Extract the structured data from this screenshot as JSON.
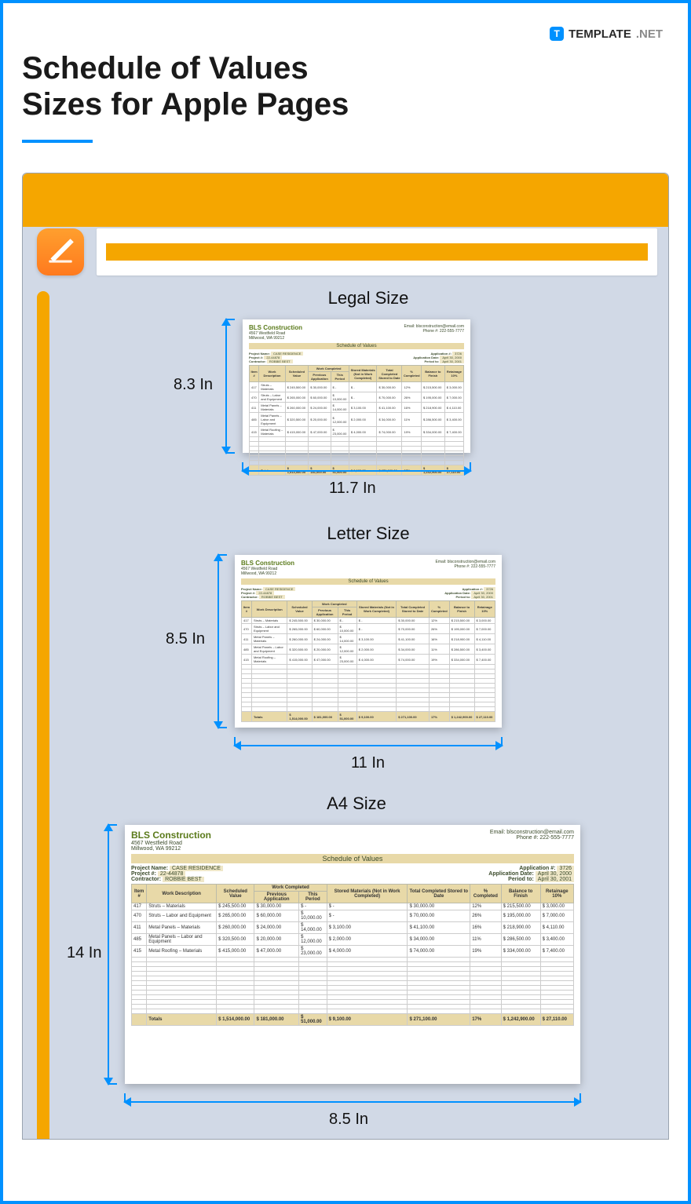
{
  "brand": {
    "name": "TEMPLATE",
    "suffix": ".NET",
    "icon_letter": "T"
  },
  "page_title_line1": "Schedule of Values",
  "page_title_line2": "Sizes for Apple Pages",
  "sizes": [
    {
      "label": "Legal Size",
      "height": "8.3 In",
      "width": "11.7 In"
    },
    {
      "label": "Letter Size",
      "height": "8.5 In",
      "width": "11 In"
    },
    {
      "label": "A4 Size",
      "height": "14 In",
      "width": "8.5 In"
    }
  ],
  "sample_doc": {
    "company": "BLS Construction",
    "address1": "4567 Westfield Road",
    "address2": "Millwood, WA 99212",
    "email_label": "Email:",
    "email": "blsconstruction@email.com",
    "phone_label": "Phone #:",
    "phone": "222-555-7777",
    "title": "Schedule of Values",
    "left_fields": {
      "project_name_label": "Project Name:",
      "project_name": "CASE RESIDENCE",
      "project_no_label": "Project #:",
      "project_no": "22-44878",
      "contractor_label": "Contractor:",
      "contractor": "ROBBIE BEST"
    },
    "right_fields": {
      "application_no_label": "Application #:",
      "application_no": "3726",
      "application_date_label": "Application Date:",
      "application_date": "April 30, 2000",
      "period_to_label": "Period to:",
      "period_to": "April 30, 2001"
    },
    "columns": [
      "Item #",
      "Work Description",
      "Scheduled Value",
      "Previous Application",
      "This Period",
      "Stored Materials (Not in Work Completed)",
      "Total Completed Stored to Date",
      "% Completed",
      "Balance to Finish",
      "Retainage 10%"
    ],
    "group_headers": {
      "work_completed": "Work Completed"
    },
    "rows": [
      {
        "item": "417",
        "desc": "Struts – Materials",
        "sched": "$ 245,500.00",
        "prev": "$ 30,000.00",
        "this": "$ -",
        "stored": "$ -",
        "total": "$ 30,000.00",
        "pct": "12%",
        "bal": "$ 215,500.00",
        "ret": "$ 3,000.00"
      },
      {
        "item": "470",
        "desc": "Struts – Labor and Equipment",
        "sched": "$ 265,000.00",
        "prev": "$ 60,000.00",
        "this": "$ 10,000.00",
        "stored": "$ -",
        "total": "$ 70,000.00",
        "pct": "26%",
        "bal": "$ 195,000.00",
        "ret": "$ 7,000.00"
      },
      {
        "item": "411",
        "desc": "Metal Panels – Materials",
        "sched": "$ 260,000.00",
        "prev": "$ 24,000.00",
        "this": "$ 14,000.00",
        "stored": "$ 3,100.00",
        "total": "$ 41,100.00",
        "pct": "16%",
        "bal": "$ 218,900.00",
        "ret": "$ 4,110.00"
      },
      {
        "item": "485",
        "desc": "Metal Panels – Labor and Equipment",
        "sched": "$ 320,500.00",
        "prev": "$ 20,000.00",
        "this": "$ 12,000.00",
        "stored": "$ 2,000.00",
        "total": "$ 34,000.00",
        "pct": "11%",
        "bal": "$ 286,500.00",
        "ret": "$ 3,400.00"
      },
      {
        "item": "415",
        "desc": "Metal Roofing – Materials",
        "sched": "$ 415,000.00",
        "prev": "$ 47,000.00",
        "this": "$ 23,000.00",
        "stored": "$ 4,000.00",
        "total": "$ 74,000.00",
        "pct": "19%",
        "bal": "$ 334,000.00",
        "ret": "$ 7,400.00"
      }
    ],
    "totals": {
      "label": "Totals",
      "sched": "$ 1,514,000.00",
      "prev": "$ 181,000.00",
      "this": "$ 51,000.00",
      "stored": "$ 9,100.00",
      "total": "$ 271,100.00",
      "pct": "17%",
      "bal": "$ 1,242,900.00",
      "ret": "$ 27,110.00"
    }
  }
}
